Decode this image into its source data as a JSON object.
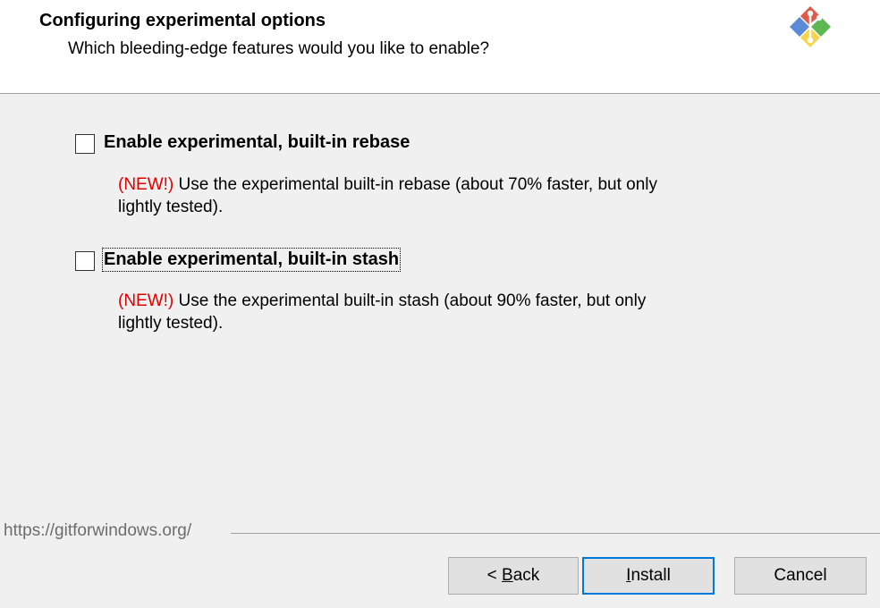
{
  "header": {
    "title": "Configuring experimental options",
    "subtitle": "Which bleeding-edge features would you like to enable?",
    "logo_icon": "git-logo-icon"
  },
  "options": [
    {
      "label": "Enable experimental, built-in rebase",
      "checked": false,
      "new_tag": "(NEW!)",
      "description_line1": " Use the experimental built-in rebase (about 70% faster, but only",
      "description_line2": "lightly tested)."
    },
    {
      "label": "Enable experimental, built-in stash",
      "checked": false,
      "new_tag": "(NEW!)",
      "description_line1": " Use the experimental built-in stash (about 90% faster, but only",
      "description_line2": "lightly tested)."
    }
  ],
  "footer": {
    "url": "https://gitforwindows.org/"
  },
  "buttons": {
    "back_prefix": "< ",
    "back_accel": "B",
    "back_rest": "ack",
    "install_accel": "I",
    "install_rest": "nstall",
    "cancel": "Cancel"
  },
  "colors": {
    "new_tag": "#e00000",
    "default_button_border": "#0078d7",
    "header_bg": "#ffffff",
    "body_bg": "#f0f0f0"
  }
}
